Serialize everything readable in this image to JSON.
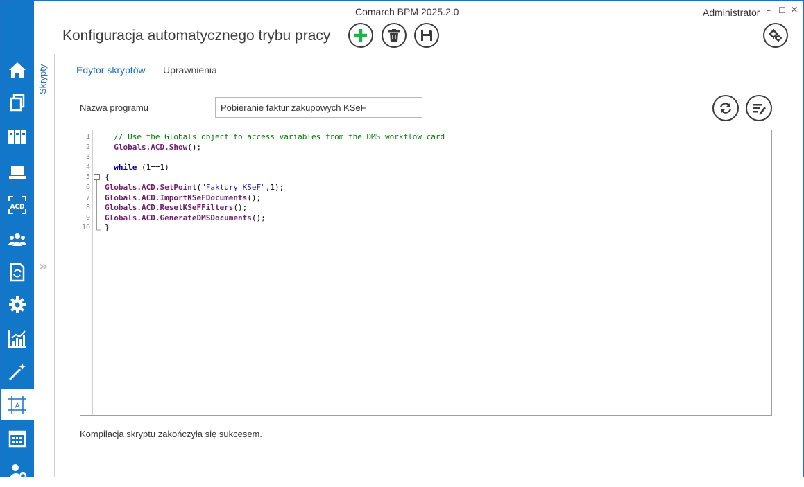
{
  "window": {
    "app_title": "Comarch BPM 2025.2.0",
    "user": "Administrator",
    "minimize": "–",
    "maximize": "☐",
    "close": "×"
  },
  "header": {
    "title": "Konfiguracja automatycznego trybu pracy",
    "buttons": [
      {
        "name": "add",
        "icon": "plus-icon",
        "color": "#1fb24a"
      },
      {
        "name": "delete",
        "icon": "trash-icon"
      },
      {
        "name": "save",
        "icon": "floppy-icon"
      },
      {
        "name": "settings",
        "icon": "gears-icon"
      }
    ]
  },
  "nav": {
    "accent": "#1277c9",
    "items": [
      {
        "icon": "home-icon"
      },
      {
        "icon": "documents-icon"
      },
      {
        "icon": "binders-icon"
      },
      {
        "icon": "laptop-icon"
      },
      {
        "icon": "acd-icon",
        "label": "ACD"
      },
      {
        "icon": "users-icon"
      },
      {
        "icon": "document-sync-icon"
      },
      {
        "icon": "gear-icon"
      },
      {
        "icon": "chart-icon"
      },
      {
        "icon": "magic-wand-icon"
      },
      {
        "icon": "text-frame-icon",
        "active": true
      },
      {
        "icon": "calendar-icon"
      },
      {
        "icon": "user-settings-icon"
      }
    ]
  },
  "side_panel": {
    "tab_label": "Skrypty",
    "expand_glyph": "»"
  },
  "tabs": [
    {
      "label": "Edytor skryptów",
      "active": true
    },
    {
      "label": "Uprawnienia",
      "active": false
    }
  ],
  "form": {
    "program_label": "Nazwa programu",
    "program_value": "Pobieranie faktur zakupowych KSeF"
  },
  "editor_buttons": [
    {
      "icon": "refresh-icon"
    },
    {
      "icon": "format-code-icon"
    }
  ],
  "code": [
    {
      "n": "1",
      "indent": "  ",
      "tokens": [
        {
          "t": "comment",
          "v": "// Use the Globals object to access variables from the DMS workflow card"
        }
      ]
    },
    {
      "n": "2",
      "indent": "  ",
      "tokens": [
        {
          "t": "obj",
          "v": "Globals.ACD.Show"
        },
        {
          "t": "plain",
          "v": "();"
        }
      ]
    },
    {
      "n": "3",
      "indent": "",
      "tokens": []
    },
    {
      "n": "4",
      "indent": "  ",
      "tokens": [
        {
          "t": "kw",
          "v": "while"
        },
        {
          "t": "plain",
          "v": " (1==1)"
        }
      ]
    },
    {
      "n": "5",
      "indent": "",
      "tokens": [
        {
          "t": "plain",
          "v": "{"
        }
      ]
    },
    {
      "n": "6",
      "indent": "",
      "tokens": [
        {
          "t": "obj",
          "v": "Globals.ACD.SetPoint"
        },
        {
          "t": "plain",
          "v": "("
        },
        {
          "t": "str",
          "v": "\"Faktury KSeF\""
        },
        {
          "t": "plain",
          "v": ",1);"
        }
      ]
    },
    {
      "n": "7",
      "indent": "",
      "tokens": [
        {
          "t": "obj",
          "v": "Globals.ACD.ImportKSeFDocuments"
        },
        {
          "t": "plain",
          "v": "();"
        }
      ]
    },
    {
      "n": "8",
      "indent": "",
      "tokens": [
        {
          "t": "obj",
          "v": "Globals.ACD.ResetKSeFFilters"
        },
        {
          "t": "plain",
          "v": "();"
        }
      ]
    },
    {
      "n": "9",
      "indent": "",
      "tokens": [
        {
          "t": "obj",
          "v": "Globals.ACD.GenerateDMSDocuments"
        },
        {
          "t": "plain",
          "v": "();"
        }
      ]
    },
    {
      "n": "10",
      "indent": "",
      "tokens": [
        {
          "t": "plain",
          "v": "}"
        }
      ]
    }
  ],
  "status": "Kompilacja skryptu zakończyła się sukcesem."
}
